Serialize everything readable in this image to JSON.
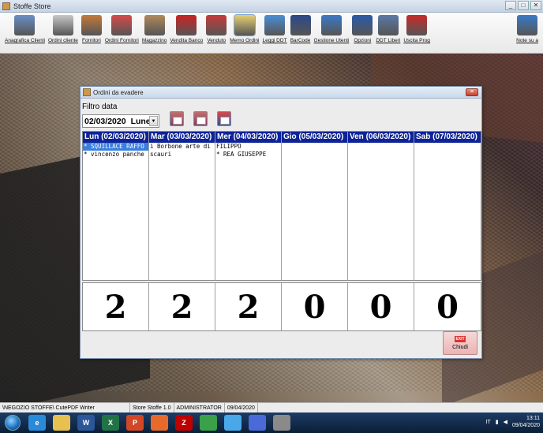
{
  "window": {
    "title": "Stoffe Store",
    "controls": [
      "_",
      "□",
      "✕"
    ]
  },
  "toolbar": {
    "items": [
      {
        "label": "Anagrafica Clienti",
        "icon": "customers-icon",
        "color": "#6a8fc8"
      },
      {
        "label": "Ordini cliente",
        "icon": "order-list-icon",
        "color": "#c8c8c8"
      },
      {
        "label": "Fornitori",
        "icon": "supplier-icon",
        "color": "#c47a3a"
      },
      {
        "label": "Ordini Fornitori",
        "icon": "supplier-orders-icon",
        "color": "#d84a4a"
      },
      {
        "label": "Magazzino",
        "icon": "warehouse-icon",
        "color": "#b08a5a"
      },
      {
        "label": "Vendita Banco",
        "icon": "sale-icon",
        "color": "#cc2222"
      },
      {
        "label": "Venduto",
        "icon": "sold-stamp-icon",
        "color": "#c83a3a"
      },
      {
        "label": "Memo Ordini",
        "icon": "memo-icon",
        "color": "#e8d070"
      },
      {
        "label": "Leggi DDT",
        "icon": "read-ddt-icon",
        "color": "#4a8fd8"
      },
      {
        "label": "BarCode",
        "icon": "barcode-icon",
        "color": "#2a4a8a"
      },
      {
        "label": "Gestione Utenti",
        "icon": "users-icon",
        "color": "#3a7ac8"
      },
      {
        "label": "Opzioni",
        "icon": "options-icon",
        "color": "#2a5aa8"
      },
      {
        "label": "DDT Liberi",
        "icon": "ddt-free-icon",
        "color": "#5a7aa8"
      },
      {
        "label": "Uscita Prog",
        "icon": "exit-program-icon",
        "color": "#c82a2a"
      },
      {
        "label": "Note su a",
        "icon": "notes-icon",
        "color": "#3a7ac8"
      }
    ],
    "active_index": 7
  },
  "dialog": {
    "title": "Ordini da evadere",
    "filter_label": "Filtro data",
    "date_value": "02/03/2020",
    "day_value": "Lunedì",
    "close_label": "Chiudi",
    "exit_badge": "EXIT"
  },
  "days": [
    {
      "header": "Lun (02/03/2020)",
      "entries": [
        "* SQUILLACE RAFFO",
        "* vincenzo panche"
      ],
      "selected": 0,
      "count": "2"
    },
    {
      "header": "Mar (03/03/2020)",
      "entries": [
        "i Borbone arte di",
        "scauri"
      ],
      "selected": -1,
      "count": "2"
    },
    {
      "header": "Mer (04/03/2020)",
      "entries": [
        "FILIPPO",
        "* REA GIUSEPPE"
      ],
      "selected": -1,
      "count": "2"
    },
    {
      "header": "Gio (05/03/2020)",
      "entries": [],
      "selected": -1,
      "count": "0"
    },
    {
      "header": "Ven (06/03/2020)",
      "entries": [],
      "selected": -1,
      "count": "0"
    },
    {
      "header": "Sab (07/03/2020)",
      "entries": [],
      "selected": -1,
      "count": "0"
    }
  ],
  "statusbar": {
    "panels": [
      "\\NEGOZIO STOFFE\\ CutePDF Writer",
      "Store Stoffe 1.0",
      "ADMINISTRATOR",
      "09/04/2020"
    ]
  },
  "taskbar": {
    "apps": [
      {
        "name": "ie-icon",
        "glyph": "e",
        "color": "#2a8ad8"
      },
      {
        "name": "explorer-icon",
        "glyph": "",
        "color": "#e8c050"
      },
      {
        "name": "word-icon",
        "glyph": "W",
        "color": "#2b579a"
      },
      {
        "name": "excel-icon",
        "glyph": "X",
        "color": "#217346"
      },
      {
        "name": "powerpoint-icon",
        "glyph": "P",
        "color": "#d24726"
      },
      {
        "name": "firefox-icon",
        "glyph": "",
        "color": "#e86a2a"
      },
      {
        "name": "filezilla-icon",
        "glyph": "Z",
        "color": "#bf0000"
      },
      {
        "name": "chrome-icon",
        "glyph": "",
        "color": "#3aa04a"
      },
      {
        "name": "photos-icon",
        "glyph": "",
        "color": "#4aa8e8"
      },
      {
        "name": "media-icon",
        "glyph": "",
        "color": "#4a6ad8"
      },
      {
        "name": "store-app-icon",
        "glyph": "",
        "color": "#8a8a8a"
      }
    ],
    "tray_lang": "IT",
    "time": "13:11",
    "date": "09/04/2020"
  }
}
